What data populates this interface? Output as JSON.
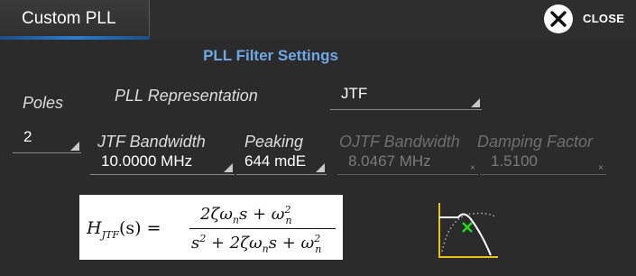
{
  "tab": {
    "title": "Custom PLL"
  },
  "close": {
    "label": "CLOSE"
  },
  "section": {
    "title": "PLL Filter Settings"
  },
  "poles": {
    "label": "Poles",
    "value": "2"
  },
  "representation": {
    "label": "PLL Representation",
    "value": "JTF"
  },
  "jtf_bandwidth": {
    "label": "JTF Bandwidth",
    "value": "10.0000 MHz"
  },
  "peaking": {
    "label": "Peaking",
    "value": "644 mdE"
  },
  "ojtf_bandwidth": {
    "label": "OJTF Bandwidth",
    "value": "8.0467 MHz"
  },
  "damping_factor": {
    "label": "Damping Factor",
    "value": "1.5100"
  },
  "equation": {
    "lhs_func": "H",
    "lhs_sub": "JTF",
    "lhs_arg": "(s) =",
    "num_coef": "2ζω",
    "num_sub": "n",
    "num_s": "s + ω",
    "num_sub2": "n",
    "num_sup2": "2",
    "den_s": "s",
    "den_sup1": "2",
    "den_mid": " + 2ζω",
    "den_sub1": "n",
    "den_s2": "s + ω",
    "den_sub2": "n",
    "den_sup2": "2"
  },
  "colors": {
    "accent_blue": "#6fa8e6",
    "tab_underline": "#2d7ad0",
    "plot_axis": "#e8c21a",
    "plot_marker": "#22dd22"
  },
  "icons": {
    "close": "close-circle-x-icon",
    "response_plot": "jtf-response-plot-icon"
  }
}
